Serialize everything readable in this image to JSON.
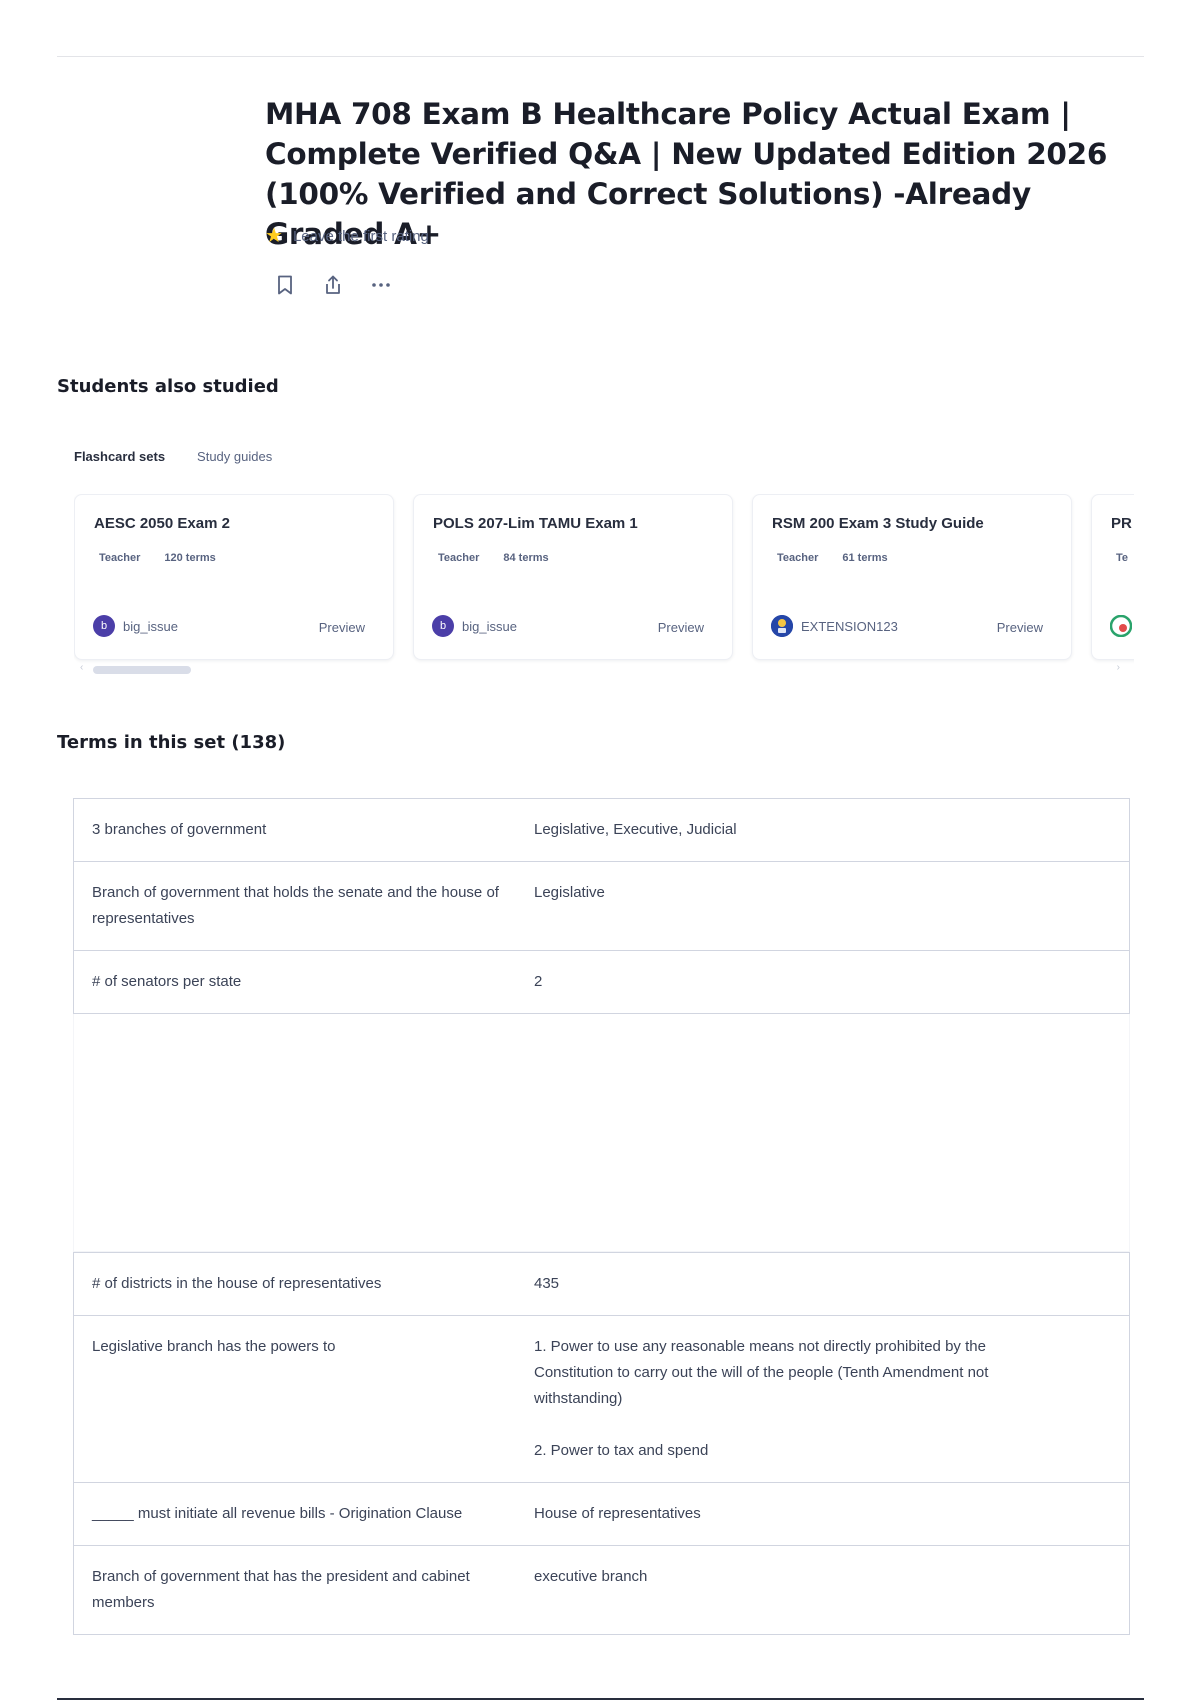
{
  "header": {
    "title": "MHA 708 Exam B Healthcare Policy Actual Exam | Complete Verified Q&A | New Updated Edition 2026 (100% Verified and Correct Solutions) -Already Graded A+",
    "rating_text": "Leave the first rating"
  },
  "students_also_studied": {
    "heading": "Students also studied",
    "tabs": [
      {
        "label": "Flashcard sets",
        "active": true
      },
      {
        "label": "Study guides",
        "active": false
      }
    ],
    "cards": [
      {
        "title": "AESC 2050 Exam 2",
        "role": "Teacher",
        "terms": "120 terms",
        "avatar_letter": "b",
        "avatar_color": "#4b3ea8",
        "user": "big_issue",
        "preview": "Preview"
      },
      {
        "title": "POLS 207-Lim TAMU Exam 1",
        "role": "Teacher",
        "terms": "84 terms",
        "avatar_letter": "b",
        "avatar_color": "#4b3ea8",
        "user": "big_issue",
        "preview": "Preview"
      },
      {
        "title": "RSM 200 Exam 3 Study Guide",
        "role": "Teacher",
        "terms": "61 terms",
        "avatar_letter": "",
        "avatar_color": "#2546a8",
        "user": "EXTENSION123",
        "preview": "Preview"
      },
      {
        "title": "PR",
        "role": "Te",
        "terms": "",
        "avatar_letter": "",
        "avatar_color": "#2aa36b",
        "user": "",
        "preview": ""
      }
    ]
  },
  "terms_section": {
    "heading": "Terms in this set (138)",
    "rows_top": [
      {
        "term": "3 branches of government",
        "definition": "Legislative, Executive, Judicial"
      },
      {
        "term": "Branch of government that holds the senate and the house of representatives",
        "definition": "Legislative"
      },
      {
        "term": "# of senators per state",
        "definition": "2"
      }
    ],
    "rows_bottom": [
      {
        "term": "# of districts in the house of representatives",
        "definition": "435"
      },
      {
        "term": "Legislative branch has the powers to",
        "definition": "1. Power to use any reasonable means not directly prohibited by the Constitution to carry out the will of the people (Tenth Amendment not withstanding)\n\n2. Power to tax and spend"
      },
      {
        "term": "_____ must initiate all revenue bills - Origination Clause",
        "definition": "House of representatives"
      },
      {
        "term": "Branch of government that has the president and cabinet members",
        "definition": "executive branch"
      }
    ]
  },
  "icons": {
    "rating": "star-icon",
    "save": "bookmark-icon",
    "share": "share-icon",
    "more": "more-icon"
  }
}
